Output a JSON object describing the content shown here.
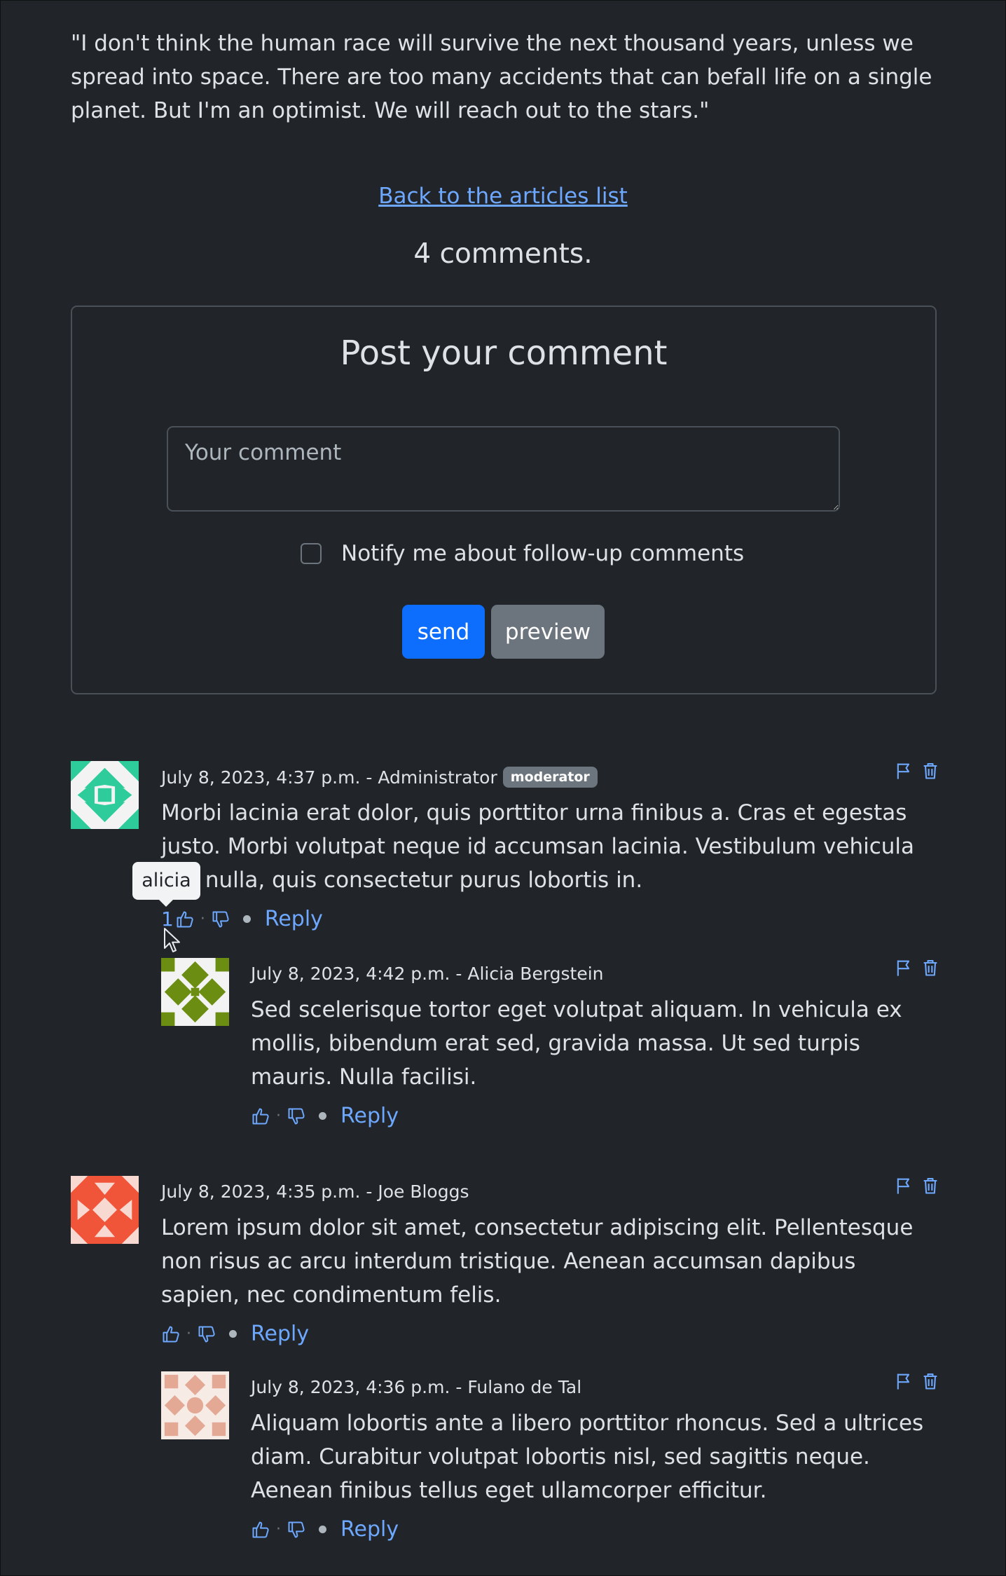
{
  "article": {
    "quote": "\"I don't think the human race will survive the next thousand years, unless we spread into space. There are too many accidents that can befall life on a single planet. But I'm an optimist. We will reach out to the stars.\"",
    "back_link": "Back to the articles list",
    "comment_count": "4 comments."
  },
  "form": {
    "title": "Post your comment",
    "comment_placeholder": "Your comment",
    "notify_label": "Notify me about follow-up comments",
    "notify_checked": false,
    "send_label": "send",
    "preview_label": "preview"
  },
  "colors": {
    "background": "#212529",
    "link": "#6ea8fe",
    "primary_button": "#0d6efd",
    "secondary_button": "#6c757d"
  },
  "comments": [
    {
      "meta": "July 8, 2023, 4:37 p.m. - Administrator",
      "badge": "moderator",
      "body": "Morbi lacinia erat dolor, quis porttitor urna finibus a. Cras et egestas justo. Morbi volutpat neque id accumsan lacinia. Vestibulum vehicula nisl nulla, quis consectetur purus lobortis in.",
      "likes": "1",
      "reply_label": "Reply",
      "avatar_color": "#2ecc9a",
      "avatar_icon": "identicon",
      "tooltip": "alicia"
    },
    {
      "meta": "July 8, 2023, 4:42 p.m. - Alicia Bergstein",
      "body": "Sed scelerisque tortor eget volutpat aliquam. In vehicula ex mollis, bibendum erat sed, gravida massa. Ut sed turpis mauris. Nulla facilisi.",
      "reply_label": "Reply",
      "avatar_color": "#6b8e12",
      "avatar_icon": "identicon"
    },
    {
      "meta": "July 8, 2023, 4:35 p.m. - Joe Bloggs",
      "body": "Lorem ipsum dolor sit amet, consectetur adipiscing elit. Pellentesque non risus ac arcu interdum tristique. Aenean accumsan dapibus sapien, nec condimentum felis.",
      "reply_label": "Reply",
      "avatar_color": "#f0553a",
      "avatar_icon": "identicon"
    },
    {
      "meta": "July 8, 2023, 4:36 p.m. - Fulano de Tal",
      "body": "Aliquam lobortis ante a libero porttitor rhoncus. Sed a ultrices diam. Curabitur volutpat lobortis nisl, sed sagittis neque. Aenean finibus tellus eget ullamcorper efficitur.",
      "reply_label": "Reply",
      "avatar_color": "#e3a994",
      "avatar_icon": "identicon"
    }
  ],
  "icons": {
    "flag": "flag-icon",
    "trash": "trash-icon",
    "like": "thumbs-up-icon",
    "dislike": "thumbs-down-icon"
  }
}
